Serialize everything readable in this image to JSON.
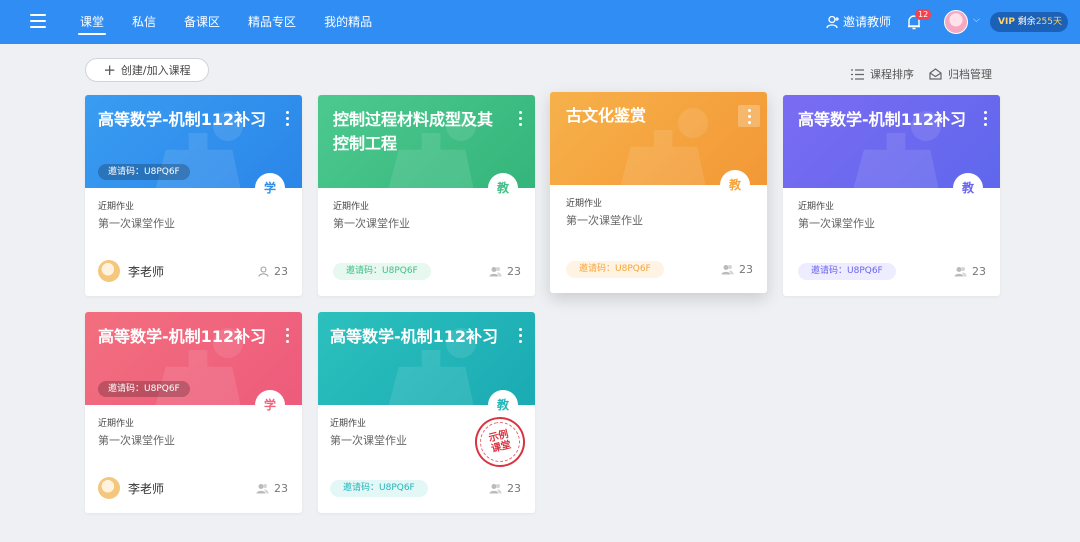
{
  "header": {
    "nav": [
      {
        "label": "课堂",
        "active": true
      },
      {
        "label": "私信",
        "active": false
      },
      {
        "label": "备课区",
        "active": false
      },
      {
        "label": "精品专区",
        "active": false
      },
      {
        "label": "我的精品",
        "active": false
      }
    ],
    "invite_label": "邀请教师",
    "notification_count": "12",
    "vip_tag": "VIP",
    "vip_remaining_prefix": "剩余",
    "vip_remaining_days": "255天"
  },
  "toolbar": {
    "create_label": "创建/加入课程",
    "sort_label": "课程排序",
    "archive_label": "归档管理"
  },
  "colors": {
    "topbar": "#2f8df4",
    "blue": "#2e90ee",
    "green": "#3fbf85",
    "orange": "#f5a43b",
    "purple": "#6a64ee",
    "pink": "#f0647e",
    "teal": "#23b6b8"
  },
  "cards": [
    {
      "title": "高等数学-机制112补习",
      "banner_code": "邀请码：U8PQ6F",
      "role": "学",
      "recent_label": "近期作业",
      "homework": "第一次课堂作业",
      "teacher": "李老师",
      "count": "23",
      "icon": "person-outline-icon"
    },
    {
      "title": "控制过程材料成型及其控制工程",
      "role": "教",
      "recent_label": "近期作业",
      "homework": "第一次课堂作业",
      "code": "邀请码：U8PQ6F",
      "count": "23",
      "icon": "people-icon"
    },
    {
      "title": "古文化鉴赏",
      "role": "教",
      "recent_label": "近期作业",
      "homework": "第一次课堂作业",
      "code": "邀请码：U8PQ6F",
      "count": "23",
      "icon": "people-icon"
    },
    {
      "title": "高等数学-机制112补习",
      "role": "教",
      "recent_label": "近期作业",
      "homework": "第一次课堂作业",
      "code": "邀请码：U8PQ6F",
      "count": "23",
      "icon": "people-icon"
    },
    {
      "title": "高等数学-机制112补习",
      "banner_code": "邀请码：U8PQ6F",
      "role": "学",
      "recent_label": "近期作业",
      "homework": "第一次课堂作业",
      "teacher": "李老师",
      "count": "23",
      "icon": "people-icon"
    },
    {
      "title": "高等数学-机制112补习",
      "role": "教",
      "recent_label": "近期作业",
      "homework": "第一次课堂作业",
      "code": "邀请码：U8PQ6F",
      "count": "23",
      "stamp": "示例课堂",
      "icon": "people-icon"
    }
  ]
}
